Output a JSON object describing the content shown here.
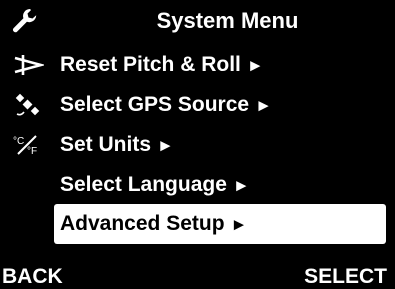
{
  "header": {
    "title": "System Menu",
    "icon": "wrench-icon"
  },
  "menu": {
    "items": [
      {
        "label": "Reset Pitch & Roll",
        "arrow": "►",
        "icon": "pitch-roll-icon",
        "selected": false
      },
      {
        "label": "Select GPS Source",
        "arrow": "►",
        "icon": "satellite-icon",
        "selected": false
      },
      {
        "label": "Set Units",
        "arrow": "►",
        "icon": "units-icon",
        "selected": false
      },
      {
        "label": "Select Language",
        "arrow": "►",
        "icon": "",
        "selected": false
      },
      {
        "label": "Advanced Setup",
        "arrow": "►",
        "icon": "",
        "selected": true
      }
    ],
    "units_icon_text": "°C⁄°F"
  },
  "softkeys": {
    "back": "BACK",
    "select": "SELECT"
  },
  "colors": {
    "background": "#000000",
    "text": "#ffffff",
    "highlight": "#ffffff",
    "highlight_text": "#000000"
  }
}
